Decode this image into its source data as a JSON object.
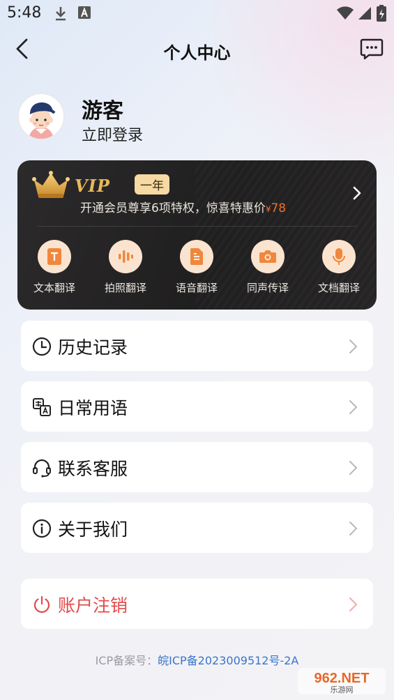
{
  "status_bar": {
    "time": "5:48"
  },
  "header": {
    "title": "个人中心"
  },
  "profile": {
    "name": "游客",
    "login_label": "立即登录"
  },
  "vip_card": {
    "vip_text": "VIP",
    "badge": "一年",
    "description": "开通会员尊享6项特权，惊喜特惠价",
    "price_symbol": "¥",
    "price": "78",
    "features": [
      {
        "label": "文本翻译",
        "icon": "text-translate-icon"
      },
      {
        "label": "拍照翻译",
        "icon": "photo-translate-icon"
      },
      {
        "label": "语音翻译",
        "icon": "voice-translate-icon"
      },
      {
        "label": "同声传译",
        "icon": "camera-icon"
      },
      {
        "label": "文档翻译",
        "icon": "microphone-icon"
      }
    ]
  },
  "menu": {
    "items": [
      {
        "label": "历史记录",
        "icon": "clock-icon"
      },
      {
        "label": "日常用语",
        "icon": "phrases-icon"
      },
      {
        "label": "联系客服",
        "icon": "headset-icon"
      },
      {
        "label": "关于我们",
        "icon": "info-icon"
      }
    ],
    "logout": {
      "label": "账户注销",
      "icon": "power-icon",
      "color": "#e24a4a"
    }
  },
  "footer": {
    "prefix": "ICP备案号：",
    "icp": "皖ICP备2023009512号-2A"
  },
  "watermark": {
    "text": "962.NET",
    "subtext": "乐游网"
  },
  "colors": {
    "accent_orange": "#ef6f2a",
    "vip_gold": "#e6b95a",
    "link_blue": "#3a74c9"
  }
}
